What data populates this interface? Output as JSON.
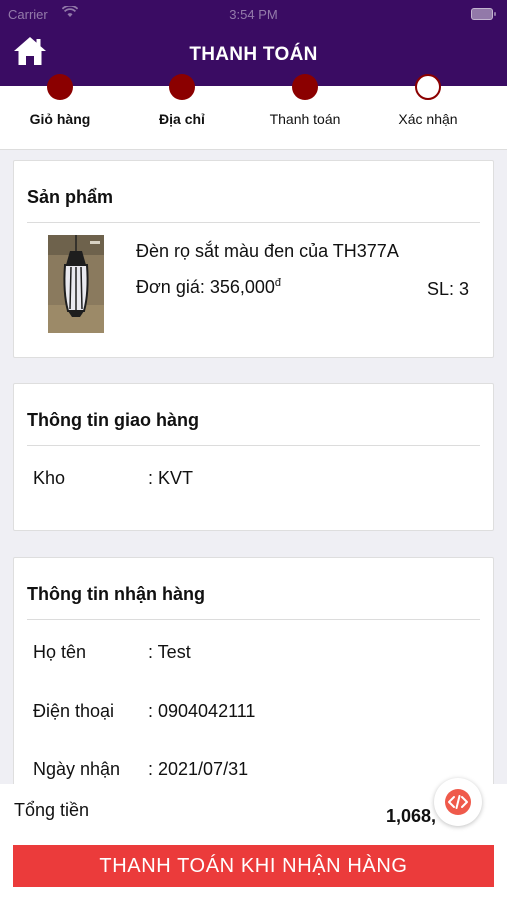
{
  "status_bar": {
    "carrier": "Carrier",
    "time": "3:54 PM"
  },
  "header": {
    "title": "THANH TOÁN",
    "home_icon": "home-icon"
  },
  "steps": [
    {
      "label": "Giỏ hàng",
      "done": true
    },
    {
      "label": "Địa chỉ",
      "done": true
    },
    {
      "label": "Thanh toán",
      "done": true
    },
    {
      "label": "Xác nhận",
      "done": false
    }
  ],
  "product_card": {
    "title": "Sản phẩm",
    "item": {
      "name": "Đèn rọ sắt màu đen của TH377A",
      "price_label": "Đơn giá: 356,000",
      "currency": "đ",
      "qty_label": "SL: 3"
    }
  },
  "delivery_card": {
    "title": "Thông tin giao hàng",
    "rows": [
      {
        "label": "Kho",
        "value": ": KVT"
      }
    ]
  },
  "receiver_card": {
    "title": "Thông tin nhận hàng",
    "rows": [
      {
        "label": "Họ tên",
        "value": ": Test"
      },
      {
        "label": "Điện thoại",
        "value": ": 0904042111"
      },
      {
        "label": "Ngày nhận",
        "value": ": 2021/07/31"
      }
    ]
  },
  "footer": {
    "total_label": "Tổng tiền",
    "total_value": "1,068,",
    "total_value_tail": "’",
    "pay_button": "THANH TOÁN KHI NHẬN HÀNG",
    "fab_icon": "code-icon"
  },
  "colors": {
    "header_bg": "#3a0c63",
    "step_dot": "#8b0000",
    "pay_button": "#eb3b3b",
    "fab": "#ef5a4b"
  }
}
